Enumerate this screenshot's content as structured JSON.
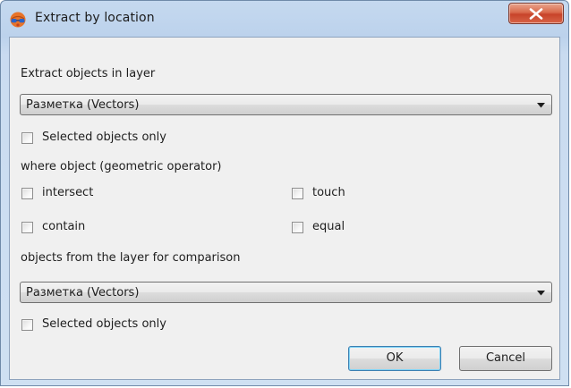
{
  "window": {
    "title": "Extract by location",
    "close_glyph": "x"
  },
  "layer": {
    "label": "Extract objects in layer",
    "selected_value": "Разметка (Vectors)",
    "selected_only_label": "Selected objects only",
    "selected_only_checked": false
  },
  "operator": {
    "label": "where object (geometric operator)",
    "options": [
      {
        "label": "intersect",
        "checked": false
      },
      {
        "label": "touch",
        "checked": false
      },
      {
        "label": "contain",
        "checked": false
      },
      {
        "label": "equal",
        "checked": false
      }
    ]
  },
  "comparison": {
    "label": "objects from the layer for comparison",
    "selected_value": "Разметка (Vectors)",
    "selected_only_label": "Selected objects only",
    "selected_only_checked": false
  },
  "buttons": {
    "ok": "OK",
    "cancel": "Cancel"
  },
  "icons": {
    "app": "globe-with-glasses-icon",
    "close": "close-icon",
    "dropdown": "chevron-down-icon"
  }
}
